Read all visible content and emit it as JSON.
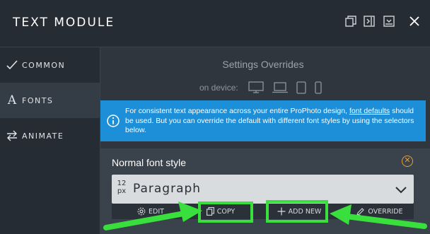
{
  "window": {
    "title": "TEXT MODULE",
    "controls": [
      "duplicate-icon",
      "collapse-panel-icon",
      "minimize-icon",
      "close-icon"
    ]
  },
  "sidebar": {
    "items": [
      {
        "label": "COMMON",
        "icon": "check-icon",
        "active": false
      },
      {
        "label": "FONTS",
        "icon": "font-icon",
        "active": true
      },
      {
        "label": "ANIMATE",
        "icon": "swap-arrows-icon",
        "active": false
      }
    ]
  },
  "overrides": {
    "title": "Settings Overrides",
    "device_label": "on device:",
    "devices": [
      "desktop-icon",
      "laptop-icon",
      "tablet-icon",
      "phone-icon"
    ]
  },
  "info": {
    "text_before": "For consistent text appearance across your entire ProPhoto design, ",
    "link": "font defaults",
    "text_after": " should be used. But you can override the default with different font styles by using the selectors below."
  },
  "font_style": {
    "title": "Normal font style",
    "size_value": "12",
    "size_unit": "px",
    "selected": "Paragraph"
  },
  "actions": {
    "edit": "EDIT",
    "copy": "COPY",
    "add_new": "ADD NEW",
    "override": "OVERRIDE"
  },
  "colors": {
    "accent_info": "#1d8ed8",
    "highlight": "#39e03d",
    "close_accent": "#e0a23a"
  }
}
